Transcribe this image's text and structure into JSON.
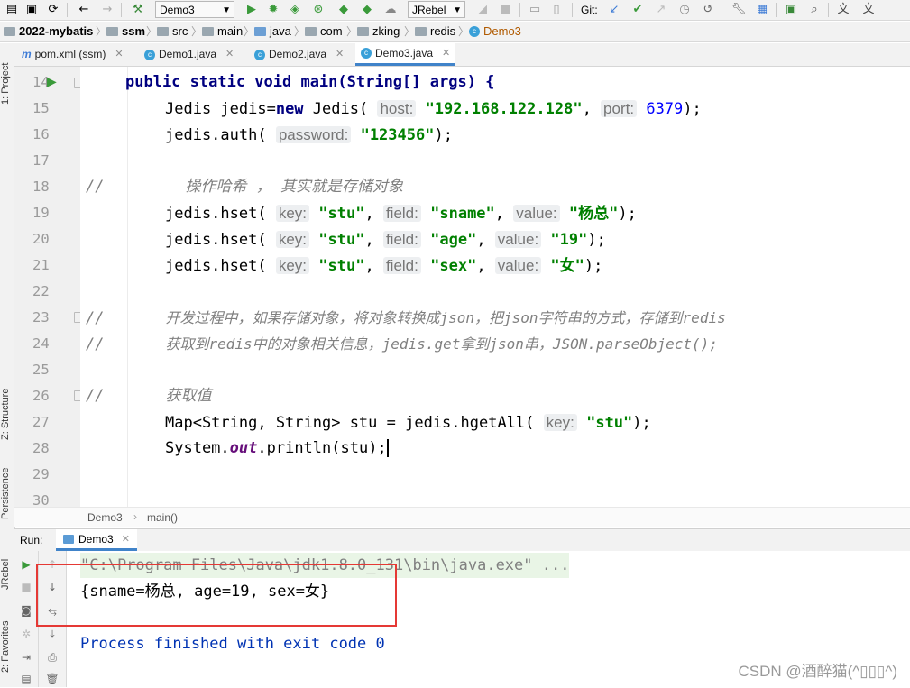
{
  "toolbar": {
    "run_config": "Demo3",
    "jrebel": "JRebel",
    "git_label": "Git:"
  },
  "breadcrumb": {
    "items": [
      "2022-mybatis",
      "ssm",
      "src",
      "main",
      "java",
      "com",
      "zking",
      "redis",
      "Demo3"
    ]
  },
  "tabs": [
    {
      "label": "pom.xml (ssm)",
      "icon": "maven-icon"
    },
    {
      "label": "Demo1.java",
      "icon": "class-icon"
    },
    {
      "label": "Demo2.java",
      "icon": "class-icon"
    },
    {
      "label": "Demo3.java",
      "icon": "class-icon",
      "active": true
    }
  ],
  "left_strip": {
    "project": "1: Project",
    "structure": "Z: Structure",
    "persistence": "Persistence",
    "jrebel": "JRebel",
    "favorites": "2: Favorites"
  },
  "code": {
    "lines": [
      14,
      15,
      16,
      17,
      18,
      19,
      20,
      21,
      22,
      23,
      24,
      25,
      26,
      27,
      28,
      29,
      30
    ],
    "l14": "public static void main(String[] args) {",
    "l15_pre": "Jedis jedis=",
    "l15_new": "new",
    "l15_mid": " Jedis(",
    "l15_host": "host:",
    "l15_hostval": "\"192.168.122.128\"",
    "l15_port": "port:",
    "l15_portval": "6379",
    "l15_end": ");",
    "l16_pre": "jedis.auth(",
    "l16_hint": "password:",
    "l16_val": "\"123456\"",
    "l16_end": ");",
    "l18_slash": "//",
    "l18_text": "操作哈希 ， 其实就是存储对象",
    "hset": "jedis.hset(",
    "key": "key:",
    "field": "field:",
    "value": "value:",
    "stu": "\"stu\"",
    "l19_f": "\"sname\"",
    "l19_v": "\"杨总\"",
    "l20_f": "\"age\"",
    "l20_v": "\"19\"",
    "l21_f": "\"sex\"",
    "l21_v": "\"女\"",
    "end": ");",
    "comma": ",",
    "l23_slash": "//",
    "l23_text": "开发过程中，如果存储对象，将对象转换成json，把json字符串的方式，存储到redis",
    "l24_slash": "//",
    "l24_text": "获取到redis中的对象相关信息，jedis.get拿到json串，JSON.parseObject();",
    "l26_slash": "//",
    "l26_text": "获取值",
    "l27_pre": "Map<String, String> stu = jedis.hgetAll(",
    "l27_key": "key:",
    "l27_val": "\"stu\"",
    "l27_end": ");",
    "l28_pre": "System.",
    "l28_out": "out",
    "l28_end": ".println(stu);"
  },
  "editor_breadcrumb": {
    "cls": "Demo3",
    "method": "main()"
  },
  "run": {
    "label": "Run:",
    "tab": "Demo3",
    "cmd": "\"C:\\Program Files\\Java\\jdk1.8.0_131\\bin\\java.exe\" ...",
    "output": "{sname=杨总, age=19, sex=女}",
    "exit": "Process finished with exit code 0"
  },
  "watermark": "CSDN @酒醉猫(^▯▯▯^)",
  "colors": {
    "keyword": "#000080",
    "string": "#008000",
    "number": "#0000ff",
    "highlight": "#e53935",
    "accent": "#4083c9"
  }
}
